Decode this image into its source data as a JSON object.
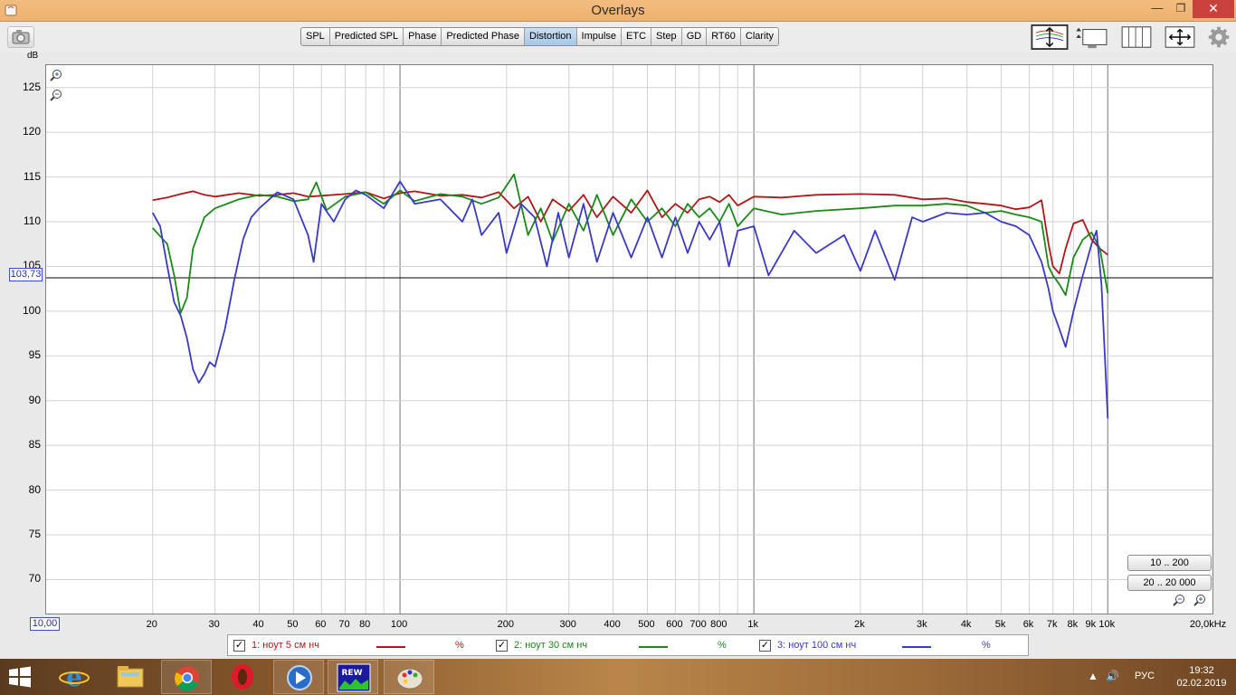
{
  "window": {
    "title": "Overlays",
    "minimize": "—",
    "maximize": "❐",
    "close": "✕"
  },
  "toolbar": {
    "tabs": [
      {
        "label": "SPL",
        "active": false
      },
      {
        "label": "Predicted SPL",
        "active": false
      },
      {
        "label": "Phase",
        "active": false
      },
      {
        "label": "Predicted Phase",
        "active": false
      },
      {
        "label": "Distortion",
        "active": true
      },
      {
        "label": "Impulse",
        "active": false
      },
      {
        "label": "ETC",
        "active": false
      },
      {
        "label": "Step",
        "active": false
      },
      {
        "label": "GD",
        "active": false
      },
      {
        "label": "RT60",
        "active": false
      },
      {
        "label": "Clarity",
        "active": false
      }
    ]
  },
  "plot": {
    "y_unit": "dB",
    "cursor_y": "103,73",
    "cursor_x": "10,00",
    "range_buttons": [
      "10 .. 200",
      "20 .. 20 000"
    ]
  },
  "chart_data": {
    "type": "line",
    "xscale": "log",
    "xlim": [
      10,
      20000
    ],
    "ylim": [
      66,
      127.5
    ],
    "ylabel": "dB",
    "yticks": [
      70,
      75,
      80,
      85,
      90,
      95,
      100,
      105,
      110,
      115,
      120,
      125
    ],
    "xticks": [
      {
        "value": 20,
        "label": "20"
      },
      {
        "value": 30,
        "label": "30"
      },
      {
        "value": 40,
        "label": "40"
      },
      {
        "value": 50,
        "label": "50"
      },
      {
        "value": 60,
        "label": "60"
      },
      {
        "value": 70,
        "label": "70"
      },
      {
        "value": 80,
        "label": "80"
      },
      {
        "value": 100,
        "label": "100"
      },
      {
        "value": 200,
        "label": "200"
      },
      {
        "value": 300,
        "label": "300"
      },
      {
        "value": 400,
        "label": "400"
      },
      {
        "value": 500,
        "label": "500"
      },
      {
        "value": 600,
        "label": "600"
      },
      {
        "value": 700,
        "label": "700"
      },
      {
        "value": 800,
        "label": "800"
      },
      {
        "value": 1000,
        "label": "1k"
      },
      {
        "value": 2000,
        "label": "2k"
      },
      {
        "value": 3000,
        "label": "3k"
      },
      {
        "value": 4000,
        "label": "4k"
      },
      {
        "value": 5000,
        "label": "5k"
      },
      {
        "value": 6000,
        "label": "6k"
      },
      {
        "value": 7000,
        "label": "7k"
      },
      {
        "value": 8000,
        "label": "8k"
      },
      {
        "value": 9000,
        "label": "9k"
      },
      {
        "value": 10000,
        "label": "10k"
      },
      {
        "value": 20000,
        "label": "20,0kHz"
      }
    ],
    "major_gridlines_x": [
      100,
      1000,
      10000
    ],
    "cursor_line_y": 103.73,
    "grid": true,
    "series": [
      {
        "name": "1: ноут 5 см нч",
        "unit": "%",
        "color": "#b01818",
        "checked": true,
        "x": [
          20,
          22,
          24,
          26,
          28,
          30,
          35,
          40,
          45,
          50,
          55,
          60,
          70,
          80,
          90,
          100,
          110,
          130,
          150,
          170,
          190,
          210,
          230,
          250,
          270,
          300,
          330,
          360,
          400,
          450,
          500,
          550,
          600,
          650,
          700,
          750,
          800,
          850,
          900,
          1000,
          1200,
          1500,
          2000,
          2500,
          3000,
          3500,
          4000,
          4500,
          5000,
          5500,
          6000,
          6500,
          6800,
          7000,
          7300,
          7600,
          8000,
          8500,
          9000,
          9500,
          10000
        ],
        "y": [
          112.4,
          112.7,
          113.1,
          113.4,
          113.0,
          112.8,
          113.2,
          112.9,
          113.0,
          113.2,
          112.8,
          112.9,
          113.1,
          113.3,
          112.6,
          113.2,
          113.4,
          112.9,
          113.0,
          112.7,
          113.3,
          111.5,
          112.8,
          110.0,
          112.5,
          111.2,
          113.0,
          110.5,
          112.8,
          111.0,
          113.5,
          110.5,
          112.0,
          111.0,
          112.5,
          112.8,
          112.2,
          113.0,
          111.8,
          112.8,
          112.7,
          113.0,
          113.1,
          113.0,
          112.5,
          112.6,
          112.2,
          112.0,
          111.8,
          111.4,
          111.6,
          112.4,
          107.5,
          105.0,
          104.2,
          107.0,
          109.8,
          110.2,
          108.0,
          107.0,
          106.3
        ]
      },
      {
        "name": "2: ноут 30 см нч",
        "unit": "%",
        "color": "#1a8a1a",
        "checked": true,
        "x": [
          20,
          22,
          23,
          24,
          25,
          26,
          28,
          30,
          35,
          40,
          45,
          50,
          55,
          58,
          62,
          70,
          80,
          90,
          100,
          110,
          130,
          150,
          170,
          190,
          210,
          230,
          250,
          270,
          300,
          330,
          360,
          400,
          450,
          500,
          550,
          600,
          650,
          700,
          750,
          800,
          850,
          900,
          1000,
          1200,
          1500,
          2000,
          2500,
          3000,
          3500,
          4000,
          4500,
          5000,
          5500,
          6000,
          6500,
          6800,
          7000,
          7300,
          7600,
          8000,
          8500,
          9000,
          9500,
          10000
        ],
        "y": [
          109.3,
          107.5,
          104.0,
          99.8,
          101.5,
          107.0,
          110.5,
          111.5,
          112.5,
          113.0,
          112.8,
          112.3,
          112.5,
          114.4,
          111.3,
          112.8,
          113.3,
          112.0,
          113.5,
          112.3,
          113.1,
          112.8,
          112.0,
          112.7,
          115.3,
          108.5,
          111.5,
          107.8,
          112.0,
          109.0,
          113.0,
          108.5,
          112.5,
          110.0,
          111.5,
          109.5,
          112.0,
          110.5,
          111.5,
          110.0,
          112.0,
          109.5,
          111.5,
          110.8,
          111.2,
          111.5,
          111.8,
          111.8,
          112.0,
          111.8,
          111.0,
          111.2,
          110.8,
          110.5,
          110.0,
          105.0,
          104.0,
          103.0,
          101.8,
          106.0,
          108.0,
          108.8,
          107.0,
          102.0
        ]
      },
      {
        "name": "3: ноут 100 см нч",
        "unit": "%",
        "color": "#3a3ac8",
        "checked": true,
        "x": [
          20,
          21,
          22,
          23,
          24,
          25,
          26,
          27,
          28,
          29,
          30,
          32,
          34,
          36,
          38,
          40,
          45,
          50,
          55,
          57,
          60,
          65,
          70,
          75,
          80,
          90,
          100,
          110,
          130,
          150,
          160,
          170,
          190,
          200,
          220,
          240,
          260,
          280,
          300,
          330,
          360,
          400,
          450,
          500,
          550,
          600,
          650,
          700,
          750,
          800,
          850,
          900,
          1000,
          1100,
          1300,
          1500,
          1800,
          2000,
          2200,
          2500,
          2800,
          3000,
          3500,
          4000,
          4500,
          5000,
          5500,
          6000,
          6500,
          6800,
          7000,
          7300,
          7600,
          8000,
          8500,
          9000,
          9300,
          9600,
          10000
        ],
        "y": [
          111.0,
          109.5,
          105.0,
          101.0,
          99.5,
          97.0,
          93.5,
          92.0,
          93.0,
          94.3,
          93.8,
          98.0,
          103.5,
          108.0,
          110.5,
          111.5,
          113.3,
          112.5,
          108.5,
          105.5,
          112.0,
          110.0,
          112.5,
          113.5,
          113.0,
          111.5,
          114.5,
          112.0,
          112.5,
          110.0,
          112.5,
          108.5,
          111.0,
          106.5,
          112.0,
          110.5,
          105.0,
          111.0,
          106.0,
          112.0,
          105.5,
          111.0,
          106.0,
          110.5,
          106.0,
          110.5,
          106.5,
          110.0,
          108.0,
          110.0,
          105.0,
          109.0,
          109.5,
          104.0,
          109.0,
          106.5,
          108.5,
          104.5,
          109.0,
          103.5,
          110.5,
          110.0,
          111.0,
          110.8,
          111.0,
          110.0,
          109.5,
          108.5,
          105.5,
          102.5,
          100.0,
          98.0,
          96.0,
          100.0,
          104.0,
          107.5,
          109.0,
          103.0,
          88.0
        ]
      }
    ]
  },
  "taskbar": {
    "apps": [
      "internet-explorer",
      "file-explorer",
      "chrome",
      "opera",
      "media-player",
      "rew",
      "paint"
    ],
    "language": "РУС",
    "time": "19:32",
    "date": "02.02.2019"
  }
}
